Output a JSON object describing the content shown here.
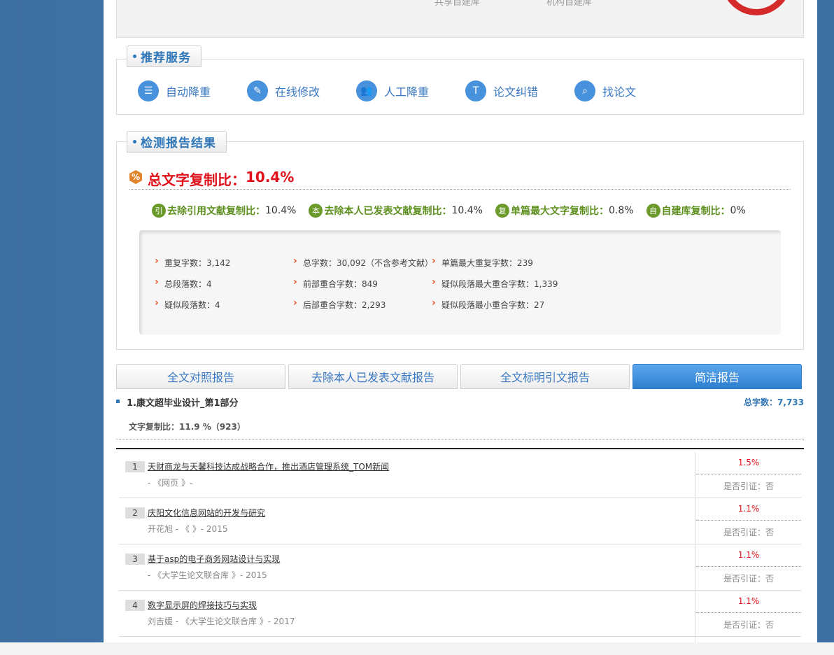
{
  "top_stub": {
    "cut_labels": [
      "共享自建库",
      "机构自建库"
    ]
  },
  "services": {
    "title": "推荐服务",
    "items": [
      {
        "label": "自动降重",
        "icon": "sort-icon",
        "glyph": "☰"
      },
      {
        "label": "在线修改",
        "icon": "pencil-icon",
        "glyph": "✎"
      },
      {
        "label": "人工降重",
        "icon": "users-icon",
        "glyph": "👥"
      },
      {
        "label": "论文纠错",
        "icon": "text-icon",
        "glyph": "T"
      },
      {
        "label": "找论文",
        "icon": "search-icon",
        "glyph": "⌕"
      }
    ]
  },
  "results": {
    "title": "检测报告结果",
    "total_label": "总文字复制比：",
    "total_value": "10.4%",
    "total_badge": "%",
    "metrics": [
      {
        "glyph": "引",
        "label": "去除引用文献复制比：",
        "value": "10.4%"
      },
      {
        "glyph": "本",
        "label": "去除本人已发表文献复制比：",
        "value": "10.4%"
      },
      {
        "glyph": "复",
        "label": "单篇最大文字复制比：",
        "value": "0.8%"
      },
      {
        "glyph": "自",
        "label": "自建库复制比：",
        "value": "0%"
      }
    ],
    "stats": [
      "重复字数：3,142",
      "总字数：30,092（不含参考文献）",
      "单篇最大重复字数：239",
      "总段落数：4",
      "前部重合字数：849",
      "疑似段落最大重合字数：1,339",
      "疑似段落数：4",
      "后部重合字数：2,293",
      "疑似段落最小重合字数：27"
    ]
  },
  "report_tabs": [
    "全文对照报告",
    "去除本人已发表文献报告",
    "全文标明引文报告",
    "简洁报告"
  ],
  "part": {
    "title": "1.康文超毕业设计_第1部分",
    "word_total": "总字数：7,733",
    "copy_ratio": "文字复制比：11.9 %（923）"
  },
  "rows": [
    {
      "num": "1",
      "title": "天财商龙与天馨科技达成战略合作，推出酒店管理系统_TOM新闻",
      "source": "- 《网页 》-",
      "pct": "1.5%",
      "cite": "是否引证：否"
    },
    {
      "num": "2",
      "title": "庆阳文化信息网站的开发与研究",
      "source": "开花旭 - 《 》- 2015",
      "pct": "1.1%",
      "cite": "是否引证：否"
    },
    {
      "num": "3",
      "title": "基于asp的电子商务网站设计与实现",
      "source": "- 《大学生论文联合库 》- 2015",
      "pct": "1.1%",
      "cite": "是否引证：否"
    },
    {
      "num": "4",
      "title": "数字显示屏的焊接技巧与实现",
      "source": "刘吉媛 - 《大学生论文联合库 》- 2017",
      "pct": "1.1%",
      "cite": "是否引证：否"
    }
  ]
}
